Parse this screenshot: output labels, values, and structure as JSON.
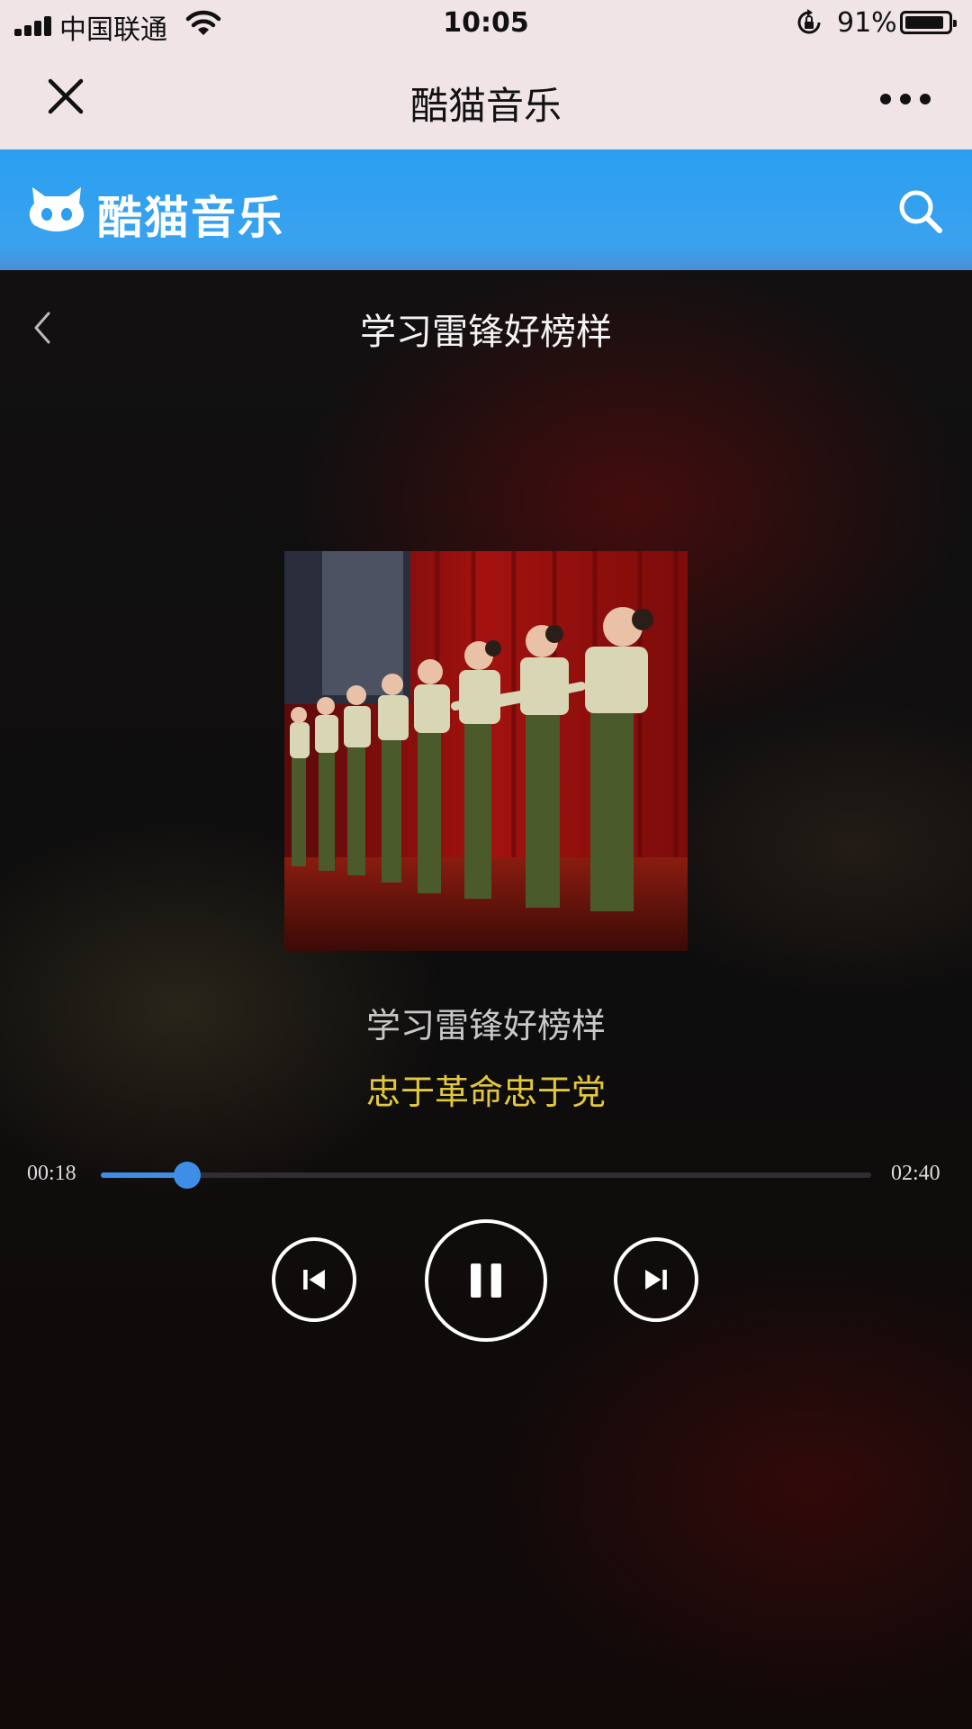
{
  "status_bar": {
    "carrier": "中国联通",
    "time": "10:05",
    "battery_percent": "91%",
    "battery_level": 0.91,
    "icons": [
      "signal-icon",
      "wifi-icon",
      "rotation-lock-icon",
      "battery-icon"
    ]
  },
  "nav_bar": {
    "title": "酷猫音乐",
    "close_icon": "close-icon",
    "more_icon": "more-icon"
  },
  "app_header": {
    "brand_name": "酷猫音乐",
    "brand_icon": "cat-logo-icon",
    "search_icon": "search-icon",
    "color": "#2b9ff2"
  },
  "player": {
    "song_title": "学习雷锋好榜样",
    "back_icon": "chevron-left-icon",
    "album_art": "album-art-image",
    "lyrics": {
      "current": "学习雷锋好榜样",
      "next": "忠于革命忠于党"
    },
    "lyric_highlight_color": "#e2c83a",
    "progress": {
      "elapsed": "00:18",
      "total": "02:40",
      "fraction": 0.1125,
      "color": "#3e8ee8"
    },
    "controls": {
      "prev_icon": "skip-previous-icon",
      "pause_icon": "pause-icon",
      "next_icon": "skip-next-icon"
    }
  }
}
